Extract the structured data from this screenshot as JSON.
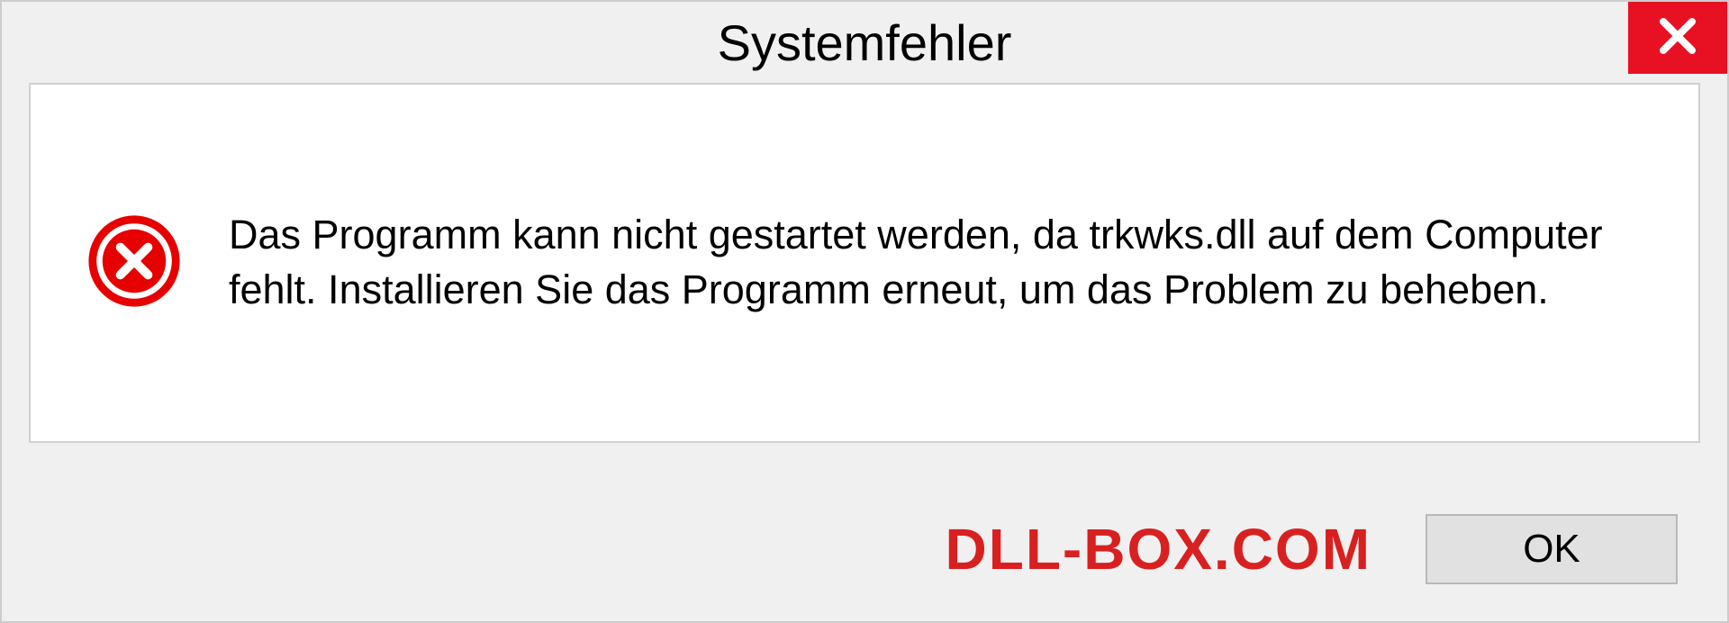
{
  "dialog": {
    "title": "Systemfehler",
    "message": "Das Programm kann nicht gestartet werden, da trkwks.dll auf dem Computer fehlt. Installieren Sie das Programm erneut, um das Problem zu beheben.",
    "ok_label": "OK"
  },
  "watermark": "DLL-BOX.COM"
}
